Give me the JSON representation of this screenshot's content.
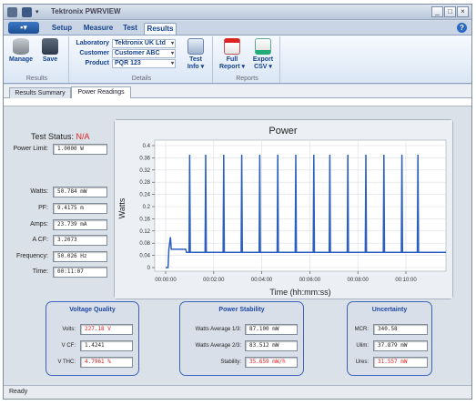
{
  "window": {
    "title": "Tektronix PWRVIEW",
    "controls": {
      "minimize": "_",
      "restore": "□",
      "close": "×"
    }
  },
  "ribbon": {
    "tabs": [
      "Setup",
      "Measure",
      "Test",
      "Results"
    ],
    "active_tab": "Results",
    "help": "?",
    "groups": {
      "results": {
        "label": "Results",
        "manage": "Manage",
        "save": "Save"
      },
      "details": {
        "label": "Details",
        "fields": [
          {
            "label": "Laboratory",
            "value": "Tektronix UK Ltd"
          },
          {
            "label": "Customer",
            "value": "Customer ABC"
          },
          {
            "label": "Product",
            "value": "PQR 123"
          }
        ],
        "test_info": [
          "Test",
          "Info ▾"
        ]
      },
      "reports": {
        "label": "Reports",
        "full_report": [
          "Full",
          "Report ▾"
        ],
        "export_csv": [
          "Export",
          "CSV ▾"
        ]
      }
    }
  },
  "doc_tabs": [
    "Results Summary",
    "Power Readings"
  ],
  "active_doc_tab": "Power Readings",
  "main": {
    "test_status_label": "Test Status:",
    "test_status_value": "N/A",
    "power_limit": {
      "label": "Power Limit:",
      "value": "1.0000 W"
    },
    "measurements": [
      {
        "label": "Watts:",
        "value": "50.784 mW"
      },
      {
        "label": "PF:",
        "value": "9.4175 m"
      },
      {
        "label": "Amps:",
        "value": "23.739 mA"
      },
      {
        "label": "A CF:",
        "value": "3.2073"
      },
      {
        "label": "Frequency:",
        "value": "50.026 Hz"
      },
      {
        "label": "Time:",
        "value": "00:11:07"
      }
    ]
  },
  "panels": {
    "voltage_quality": {
      "title": "Voltage Quality",
      "rows": [
        {
          "label": "Volts:",
          "value": "227.18 V",
          "red": true
        },
        {
          "label": "V CF:",
          "value": "1.4241",
          "red": false
        },
        {
          "label": "V THC:",
          "value": "4.7961 %",
          "red": true
        }
      ]
    },
    "power_stability": {
      "title": "Power Stability",
      "rows": [
        {
          "label": "Watts Average 1/3:",
          "value": "87.100 mW",
          "red": false
        },
        {
          "label": "Watts Average 2/3:",
          "value": "83.512 mW",
          "red": false
        },
        {
          "label": "Stability:",
          "value": "35.659 mW/h",
          "red": true
        }
      ]
    },
    "uncertainty": {
      "title": "Uncertainty",
      "rows": [
        {
          "label": "MCR:",
          "value": "340.58",
          "red": false
        },
        {
          "label": "Ulim:",
          "value": "37.879 mW",
          "red": false
        },
        {
          "label": "Ures:",
          "value": "31.557 mW",
          "red": true
        }
      ]
    }
  },
  "statusbar": {
    "text": "Ready"
  },
  "colors": {
    "accent": "#1f47a6",
    "trace": "#2a5fc0",
    "alert": "#e02020"
  },
  "chart_data": {
    "type": "line",
    "title": "Power",
    "xlabel": "Time (hh:mm:ss)",
    "ylabel": "Watts",
    "xlim": [
      0,
      700
    ],
    "ylim": [
      0,
      0.4
    ],
    "x_ticks": [
      {
        "t": 0,
        "label": "00:00:00"
      },
      {
        "t": 120,
        "label": "00:02:00"
      },
      {
        "t": 240,
        "label": "00:04:00"
      },
      {
        "t": 360,
        "label": "00:06:00"
      },
      {
        "t": 480,
        "label": "00:08:00"
      },
      {
        "t": 600,
        "label": "00:10:00"
      }
    ],
    "y_ticks": [
      "0",
      "0.04",
      "0.08",
      "0.12",
      "0.16",
      "0.2",
      "0.24",
      "0.28",
      "0.32",
      "0.36",
      "0.4"
    ],
    "grid": true,
    "series": [
      {
        "baseline": 0.05,
        "spike_peak": 0.37,
        "spikes_t": [
          60,
          100,
          145,
          190,
          235,
          280,
          325,
          370,
          410,
          455,
          500,
          545,
          590,
          630
        ]
      }
    ]
  }
}
